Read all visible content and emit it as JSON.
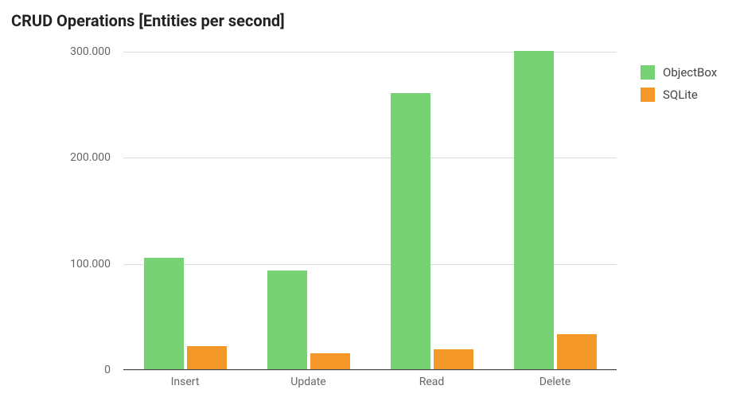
{
  "title": "CRUD Operations [Entities per second]",
  "chart_data": {
    "type": "bar",
    "categories": [
      "Insert",
      "Update",
      "Read",
      "Delete"
    ],
    "series": [
      {
        "name": "ObjectBox",
        "color": "#76d275",
        "values": [
          105000,
          93000,
          260000,
          300000
        ]
      },
      {
        "name": "SQLite",
        "color": "#f4982a",
        "values": [
          22000,
          15000,
          19000,
          33000
        ]
      }
    ],
    "ylabel": "",
    "xlabel": "",
    "ylim": [
      0,
      300000
    ],
    "yticks": [
      {
        "value": 0,
        "label": "0"
      },
      {
        "value": 100000,
        "label": "100.000"
      },
      {
        "value": 200000,
        "label": "200.000"
      },
      {
        "value": 300000,
        "label": "300.000"
      }
    ]
  }
}
